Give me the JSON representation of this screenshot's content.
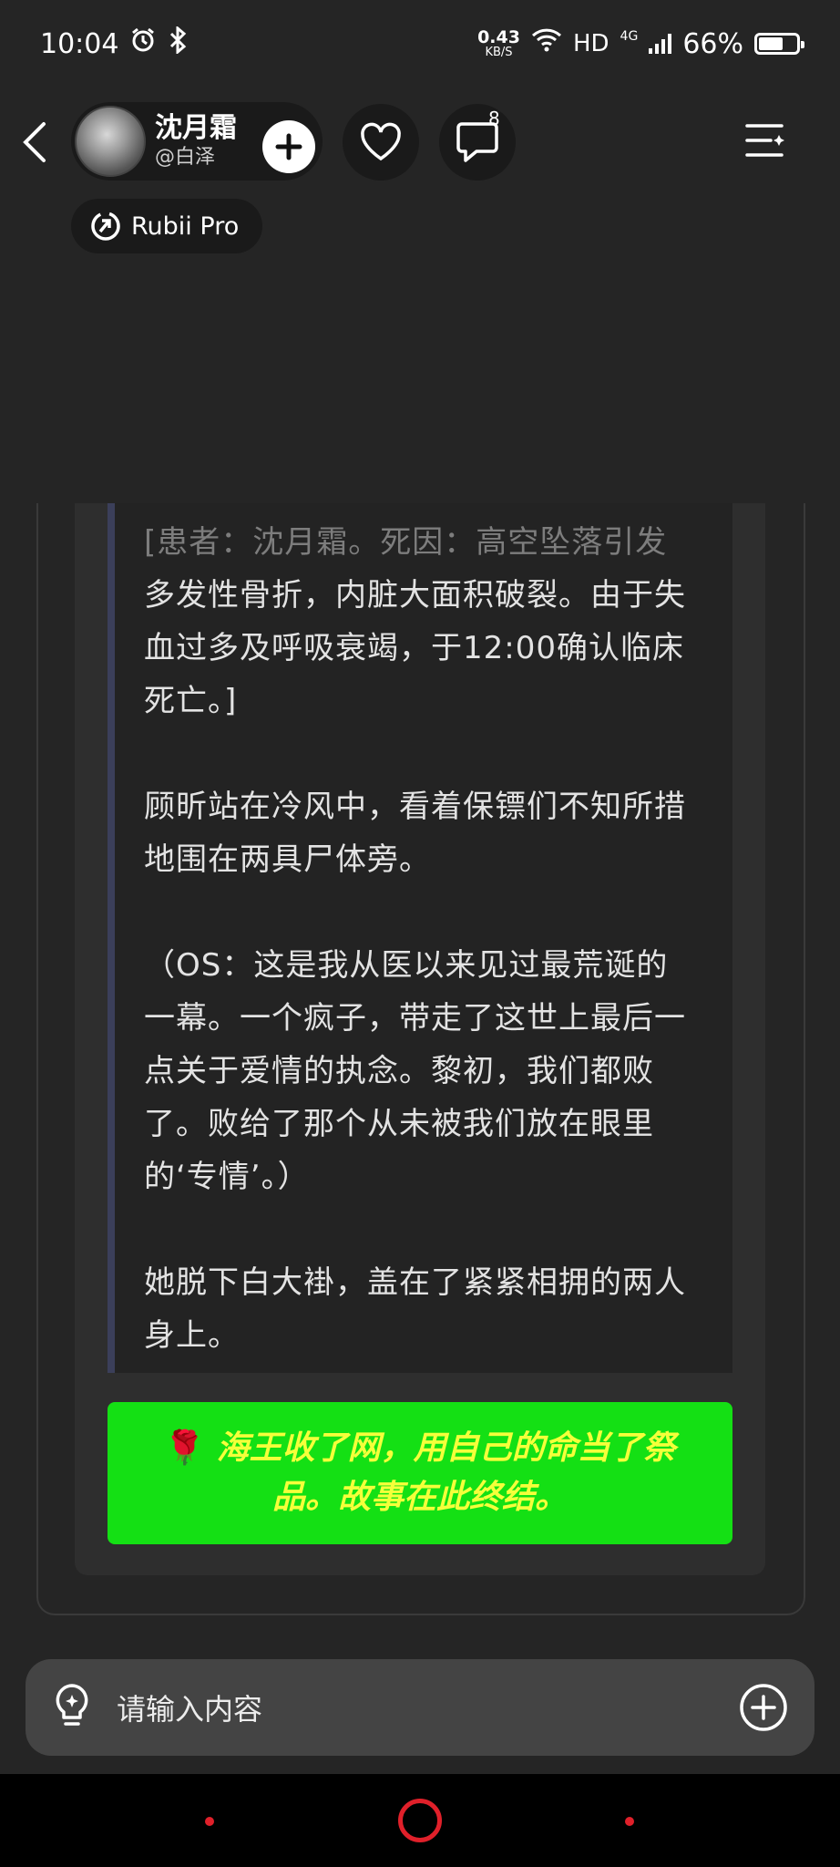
{
  "status_bar": {
    "time": "10:04",
    "net_speed_value": "0.43",
    "net_speed_unit": "KB/S",
    "network_type": "HD",
    "cell_type": "4G",
    "battery_percent": "66%",
    "battery_level": 0.66
  },
  "header": {
    "profile_name": "沈月霜",
    "profile_handle": "@白泽",
    "comment_count": "8",
    "model_badge": "Rubii Pro"
  },
  "message": {
    "paragraphs": [
      "[患者：沈月霜。死因：高空坠落引发多发性骨折，内脏大面积破裂。由于失血过多及呼吸衰竭，于12:00确认临床死亡。]",
      "顾昕站在冷风中，看着保镖们不知所措地围在两具尸体旁。",
      "（OS：这是我从医以来见过最荒诞的一幕。一个疯子，带走了这世上最后一点关于爱情的执念。黎初，我们都败了。败给了那个从未被我们放在眼里的‘专情’。）",
      "她脱下白大褂，盖在了紧紧相拥的两人身上。"
    ],
    "ending_emoji": "🌹",
    "ending_text": "海王收了网，用自己的命当了祭品。故事在此终结。"
  },
  "input": {
    "placeholder": "请输入内容"
  },
  "colors": {
    "background": "#252525",
    "ending_banner": "#14e014",
    "ending_text": "#f5ff3a",
    "nav_accent": "#e0202a"
  }
}
